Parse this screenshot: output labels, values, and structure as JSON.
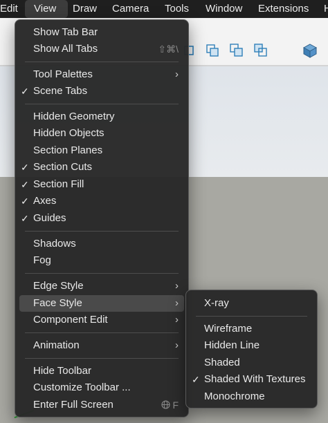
{
  "menubar": {
    "items": [
      "Edit",
      "View",
      "Draw",
      "Camera",
      "Tools",
      "Window",
      "Extensions",
      "H"
    ]
  },
  "view_menu": {
    "items": {
      "show_tab_bar": "Show Tab Bar",
      "show_all_tabs": "Show All Tabs",
      "show_all_tabs_shortcut": "⇧⌘\\",
      "tool_palettes": "Tool Palettes",
      "scene_tabs": "Scene Tabs",
      "hidden_geometry": "Hidden Geometry",
      "hidden_objects": "Hidden Objects",
      "section_planes": "Section Planes",
      "section_cuts": "Section Cuts",
      "section_fill": "Section Fill",
      "axes": "Axes",
      "guides": "Guides",
      "shadows": "Shadows",
      "fog": "Fog",
      "edge_style": "Edge Style",
      "face_style": "Face Style",
      "component_edit": "Component Edit",
      "animation": "Animation",
      "hide_toolbar": "Hide Toolbar",
      "customize_toolbar": "Customize Toolbar ...",
      "enter_full_screen": "Enter Full Screen",
      "enter_full_screen_shortcut": "F"
    },
    "checked": [
      "Scene Tabs",
      "Section Cuts",
      "Section Fill",
      "Axes",
      "Guides"
    ],
    "highlighted": "Face Style"
  },
  "face_style_menu": {
    "items": {
      "xray": "X-ray",
      "wireframe": "Wireframe",
      "hidden_line": "Hidden Line",
      "shaded": "Shaded",
      "shaded_with_textures": "Shaded With Textures",
      "monochrome": "Monochrome"
    },
    "checked": "Shaded With Textures"
  },
  "glyphs": {
    "check": "✓",
    "chevron": "›"
  },
  "colors": {
    "menu_bg": "#282828",
    "highlight": "#4a4a4a",
    "toolbar_icon": "#2f7fb8"
  }
}
